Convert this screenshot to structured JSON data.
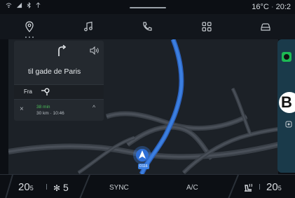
{
  "status_bar": {
    "icons": [
      "wifi-icon",
      "signal-icon",
      "bluetooth-icon",
      "hands-free-icon"
    ],
    "temperature": "16°C",
    "time": "20:2"
  },
  "top_nav": {
    "items": [
      {
        "name": "navigation",
        "icon": "map-pin-icon",
        "active": true
      },
      {
        "name": "music",
        "icon": "music-note-icon"
      },
      {
        "name": "phone",
        "icon": "phone-icon"
      },
      {
        "name": "apps",
        "icon": "apps-grid-icon"
      },
      {
        "name": "vehicle",
        "icon": "car-icon"
      }
    ]
  },
  "navigation_panel": {
    "street": "til gade  de Paris",
    "from_label": "Fra",
    "eta_minutes": "38 min",
    "eta_details": "30 km · 10:46",
    "close_symbol": "×",
    "expand_symbol": "^"
  },
  "map": {
    "route_color": "#3b7fe0",
    "position_label": "D116"
  },
  "right_widget": {
    "app_icon": "spotify-icon",
    "callout_label": "B"
  },
  "bottom_bar": {
    "temp_left": "20",
    "temp_left_suffix": "5",
    "fan_speed": "5",
    "sync_label": "SYNC",
    "ac_label": "A/C",
    "temp_right": "20",
    "temp_right_suffix": "5"
  },
  "colors": {
    "background": "#0c0f14",
    "accent_green": "#4cc05a",
    "spotify_green": "#1db954"
  }
}
